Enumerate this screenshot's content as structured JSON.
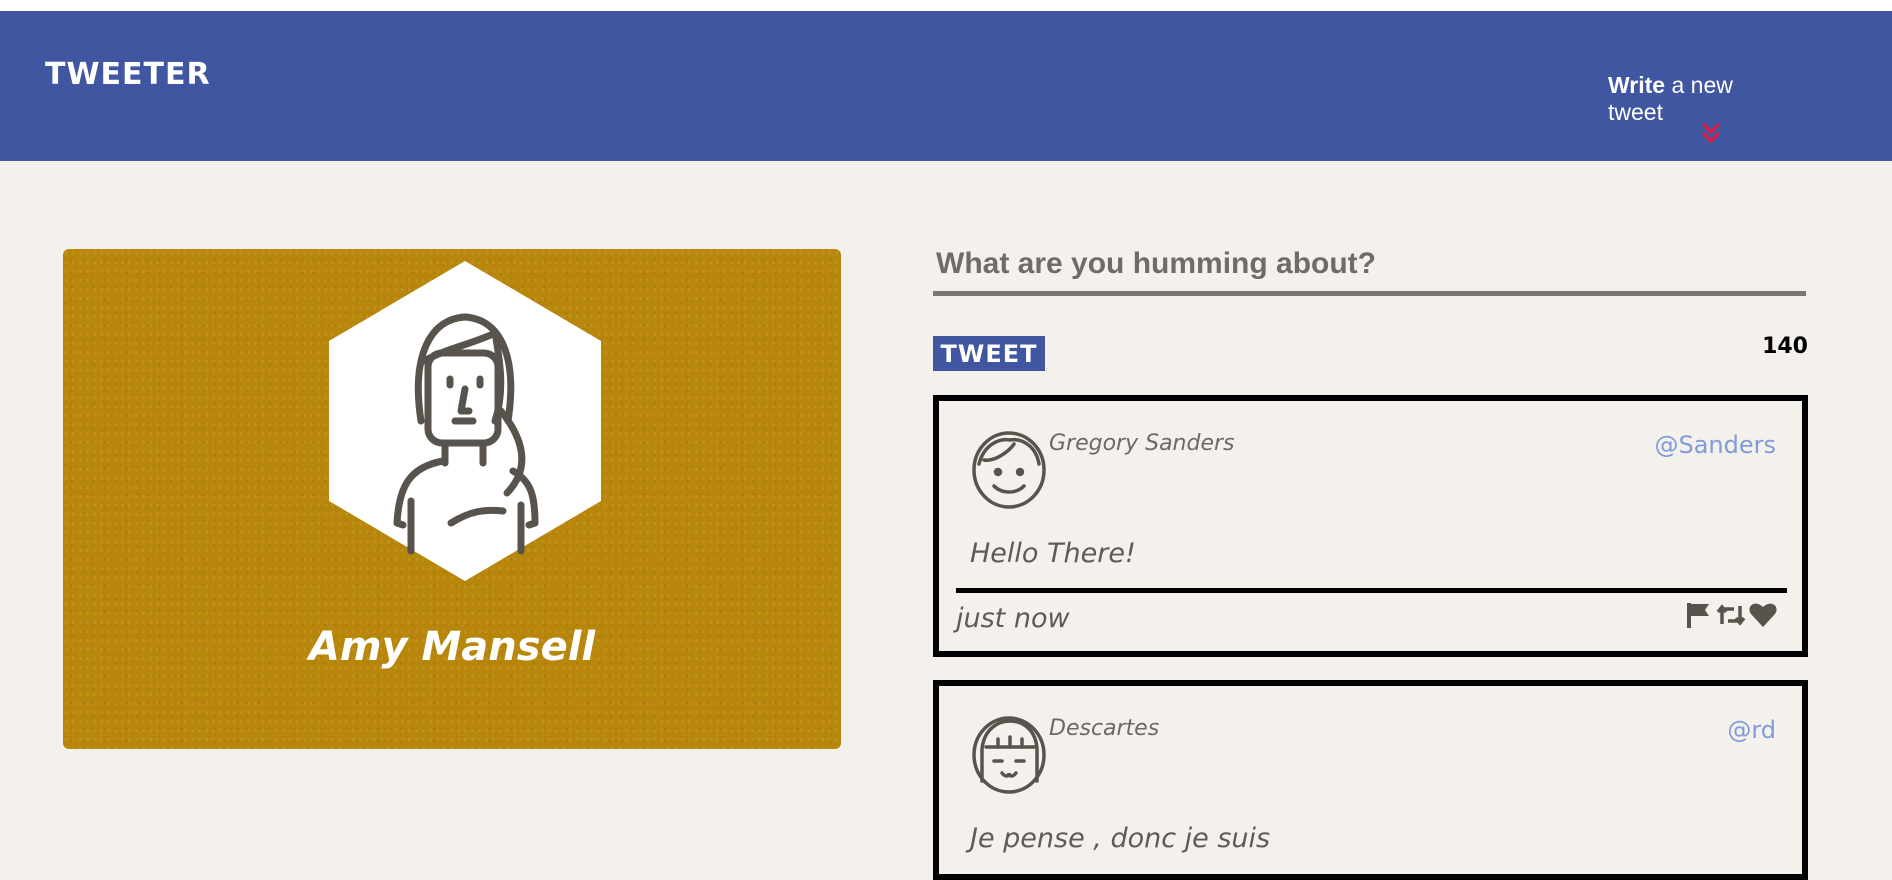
{
  "header": {
    "brand": "TWEETER",
    "compose": {
      "bold": "Write",
      "rest": " a new tweet"
    },
    "colors": {
      "bar": "#4056a1",
      "arrow": "#e8173f"
    }
  },
  "profile": {
    "name": "Amy Mansell",
    "card_color": "#b8860b"
  },
  "composer": {
    "placeholder": "What are you humming about?",
    "button_label": "TWEET",
    "counter": "140"
  },
  "tweets": [
    {
      "name": "Gregory Sanders",
      "handle": "@Sanders",
      "text": "Hello There!",
      "time": "just now",
      "actions": [
        "flag-icon",
        "retweet-icon",
        "heart-icon"
      ]
    },
    {
      "name": "Descartes",
      "handle": "@rd",
      "text": "Je pense , donc je suis"
    }
  ]
}
